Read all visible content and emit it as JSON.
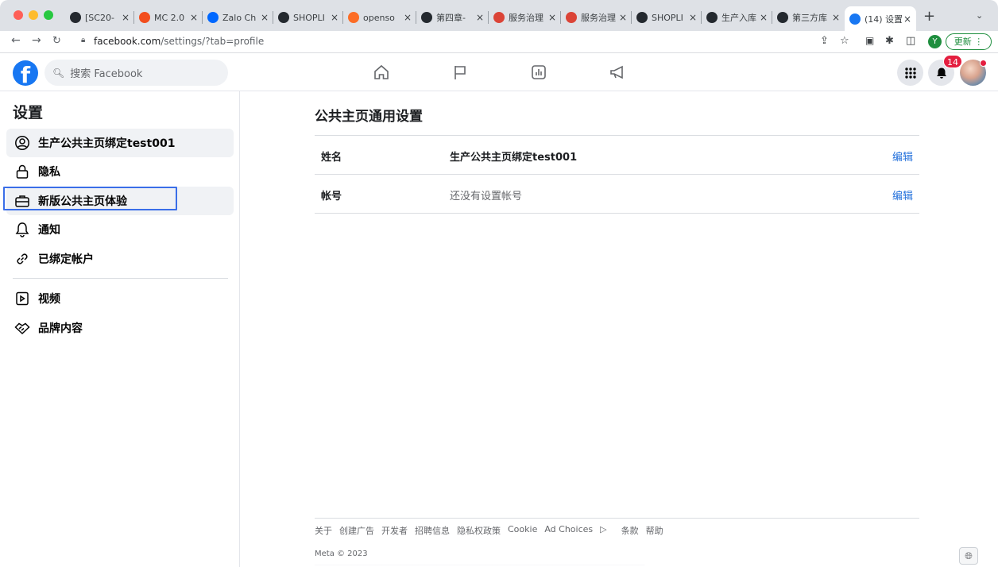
{
  "browser": {
    "tabs": [
      {
        "title": "[SC20-",
        "icon": "github-icon",
        "color": "#24292f"
      },
      {
        "title": "MC 2.0",
        "icon": "figma-icon",
        "color": "#f24e1e"
      },
      {
        "title": "Zalo Ch",
        "icon": "zalo-icon",
        "color": "#0068ff"
      },
      {
        "title": "SHOPLI",
        "icon": "github-icon",
        "color": "#24292f"
      },
      {
        "title": "openso",
        "icon": "gitlab-icon",
        "color": "#fc6d26"
      },
      {
        "title": "第四章-",
        "icon": "github-icon",
        "color": "#24292f"
      },
      {
        "title": "服务治理",
        "icon": "chrome-icon",
        "color": "#db4437"
      },
      {
        "title": "服务治理",
        "icon": "chrome-icon",
        "color": "#db4437"
      },
      {
        "title": "SHOPLI",
        "icon": "github-icon",
        "color": "#24292f"
      },
      {
        "title": "生产入库",
        "icon": "github-icon",
        "color": "#24292f"
      },
      {
        "title": "第三方库",
        "icon": "github-icon",
        "color": "#24292f"
      },
      {
        "title": "(14) 设置",
        "icon": "facebook-icon",
        "color": "#1877f2",
        "active": true
      }
    ],
    "new_tab": "+",
    "tab_close": "×",
    "url_host": "facebook.com",
    "url_path": "/settings/?tab=profile",
    "profile_letter": "Y",
    "update_label": "更新"
  },
  "header": {
    "logo": "f",
    "search_placeholder": "搜索 Facebook",
    "notification_count": "14"
  },
  "sidebar": {
    "title": "设置",
    "items": [
      {
        "label": "生产公共主页绑定test001",
        "icon": "profile-icon"
      },
      {
        "label": "隐私",
        "icon": "lock-icon"
      },
      {
        "label": "新版公共主页体验",
        "icon": "briefcase-icon"
      },
      {
        "label": "通知",
        "icon": "bell-icon"
      },
      {
        "label": "已绑定帐户",
        "icon": "link-icon"
      },
      {
        "label": "视频",
        "icon": "video-icon"
      },
      {
        "label": "品牌内容",
        "icon": "handshake-icon"
      }
    ]
  },
  "main": {
    "title": "公共主页通用设置",
    "rows": [
      {
        "key": "姓名",
        "value": "生产公共主页绑定test001",
        "action": "编辑"
      },
      {
        "key": "帐号",
        "value": "还没有设置帐号",
        "action": "编辑"
      }
    ]
  },
  "footer": {
    "links": [
      "关于",
      "创建广告",
      "开发者",
      "招聘信息",
      "隐私权政策",
      "Cookie",
      "Ad Choices",
      "条款",
      "帮助"
    ],
    "copyright": "Meta © 2023"
  },
  "colors": {
    "accent": "#1877f2",
    "link": "#216fdb",
    "highlight_box": "#3a6ee8",
    "badge": "#e41e3f"
  }
}
